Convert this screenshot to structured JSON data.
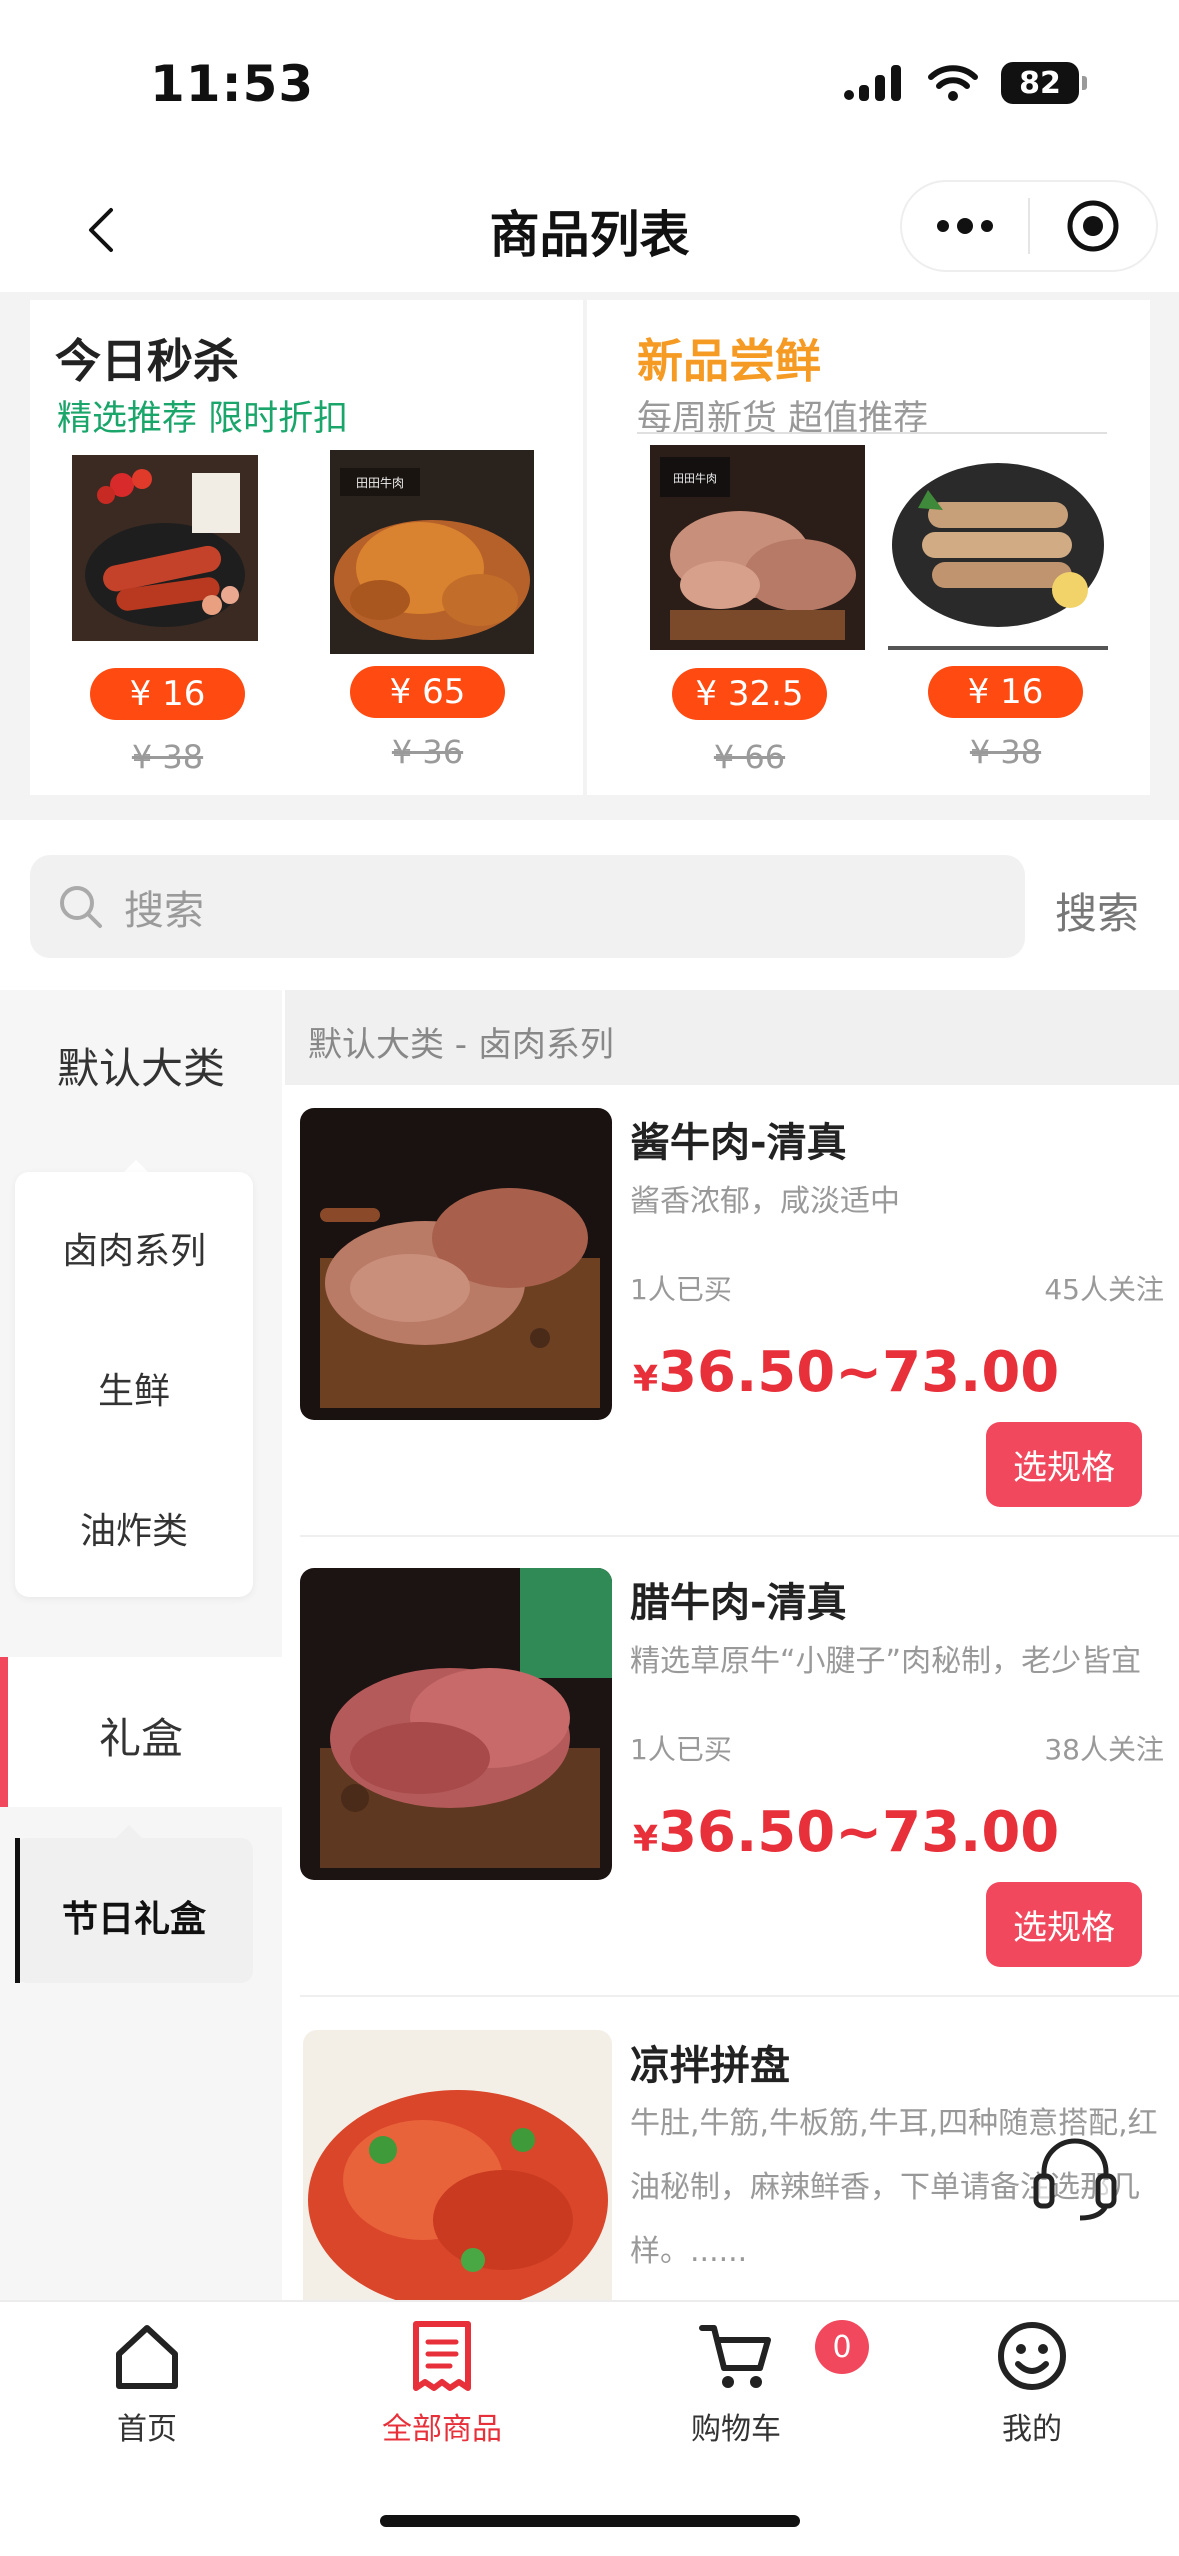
{
  "status": {
    "time": "11:53",
    "battery": "82"
  },
  "nav": {
    "title": "商品列表"
  },
  "promo": {
    "flash": {
      "title": "今日秒杀",
      "subtitle": "精选推荐 限时折扣",
      "items": [
        {
          "price": "¥ 16",
          "old_price": "¥ 38"
        },
        {
          "price": "¥ 65",
          "old_price": "¥ 36"
        }
      ]
    },
    "fresh": {
      "title": "新品尝鲜",
      "subtitle": "每周新货 超值推荐",
      "items": [
        {
          "price": "¥ 32.5",
          "old_price": "¥ 66"
        },
        {
          "price": "¥ 16",
          "old_price": "¥ 38"
        }
      ]
    }
  },
  "search": {
    "placeholder": "搜索",
    "button": "搜索"
  },
  "sidebar": {
    "categories": [
      "默认大类",
      "礼盒"
    ],
    "sub_default": [
      "卤肉系列",
      "生鲜",
      "油炸类"
    ],
    "sub_gift": [
      "节日礼盒"
    ]
  },
  "main": {
    "breadcrumb": "默认大类 - 卤肉系列",
    "products": [
      {
        "name": "酱牛肉-清真",
        "desc": "酱香浓郁，咸淡适中",
        "bought": "1人已买",
        "follow": "45人关注",
        "currency": "¥",
        "price": "36.50~73.00",
        "button": "选规格"
      },
      {
        "name": "腊牛肉-清真",
        "desc": "精选草原牛“小腱子”肉秘制，老少皆宜",
        "bought": "1人已买",
        "follow": "38人关注",
        "currency": "¥",
        "price": "36.50~73.00",
        "button": "选规格"
      },
      {
        "name": "凉拌拼盘",
        "desc": "牛肚,牛筋,牛板筋,牛耳,四种随意搭配,红油秘制，麻辣鲜香，下单请备注选那几样。......"
      }
    ]
  },
  "tabbar": {
    "items": [
      "首页",
      "全部商品",
      "购物车",
      "我的"
    ],
    "cart_count": "0"
  },
  "colors": {
    "accent": "#e8303a",
    "active_tab": "#e8303a",
    "flash_sub": "#1aa56a",
    "fresh_title": "#f59a23",
    "price_pill": "#ff4a12",
    "spec_button": "#f2485e"
  }
}
